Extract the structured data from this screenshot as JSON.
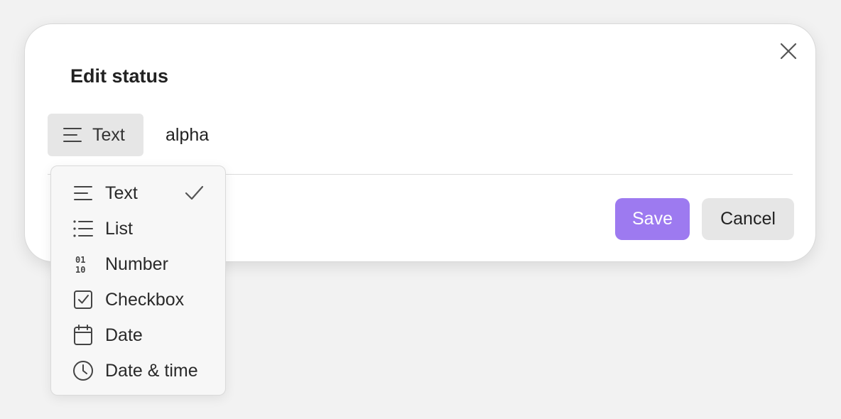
{
  "dialog": {
    "title": "Edit status",
    "close_icon": "close-icon"
  },
  "type_selector": {
    "label": "Text",
    "icon": "text-align-left-icon"
  },
  "value_input": {
    "value": "alpha"
  },
  "actions": {
    "save_label": "Save",
    "cancel_label": "Cancel",
    "save_color": "#9d7af0"
  },
  "type_menu": {
    "selected": "Text",
    "items": [
      {
        "label": "Text",
        "icon": "text-align-left-icon",
        "checked": true
      },
      {
        "label": "List",
        "icon": "bulleted-list-icon",
        "checked": false
      },
      {
        "label": "Number",
        "icon": "binary-number-icon",
        "checked": false
      },
      {
        "label": "Checkbox",
        "icon": "checkbox-icon",
        "checked": false
      },
      {
        "label": "Date",
        "icon": "calendar-icon",
        "checked": false
      },
      {
        "label": "Date & time",
        "icon": "clock-icon",
        "checked": false
      }
    ]
  }
}
